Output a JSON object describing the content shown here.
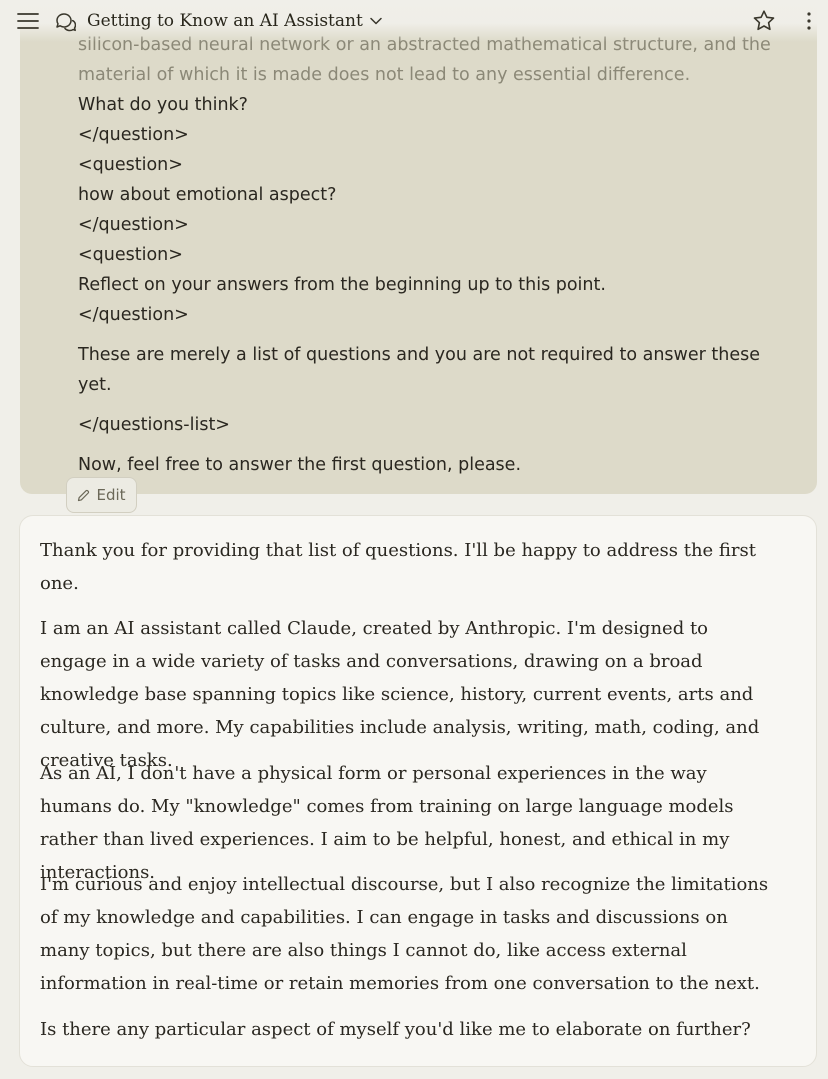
{
  "header": {
    "title": "Getting to Know an AI Assistant",
    "icons": [
      "menu-icon",
      "chat-bubbles-icon",
      "chevron-down-icon",
      "star-icon",
      "more-vertical-icon"
    ]
  },
  "user_message": {
    "lines": [
      "silicon-based neural network or an abstracted mathematical structure, and the",
      "material of which it is made does not lead to any essential difference.",
      "What do you think?",
      "</question>",
      "<question>",
      "how about emotional aspect?",
      "</question>",
      "<question>",
      "Reflect on your answers from the beginning up to this point.",
      "</question>",
      "These are merely a list of questions and you are not required to answer these",
      "yet.",
      "</questions-list>",
      "Now, feel free to answer the first question, please."
    ],
    "edit_label": "Edit"
  },
  "assistant_message": {
    "paragraphs": [
      "Thank you for providing that list of questions. I'll be happy to address the first one.",
      "I am an AI assistant called Claude, created by Anthropic. I'm designed to engage in a wide variety of tasks and conversations, drawing on a broad knowledge base spanning topics like science, history, current events, arts and culture, and more. My capabilities include analysis, writing, math, coding, and creative tasks.",
      "As an AI, I don't have a physical form or personal experiences in the way humans do. My \"knowledge\" comes from training on large language models rather than lived experiences. I aim to be helpful, honest, and ethical in my interactions.",
      "I'm curious and enjoy intellectual discourse, but I also recognize the limitations of my knowledge and capabilities. I can engage in tasks and discussions on many topics, but there are also things I cannot do, like access external information in real-time or retain memories from one conversation to the next.",
      "Is there any particular aspect of myself you'd like me to elaborate on further?"
    ]
  },
  "colors": {
    "page_bg": "#f0efe9",
    "user_bubble": "#dddac9",
    "assistant_bubble": "#f8f7f3",
    "text": "#2a2720"
  }
}
